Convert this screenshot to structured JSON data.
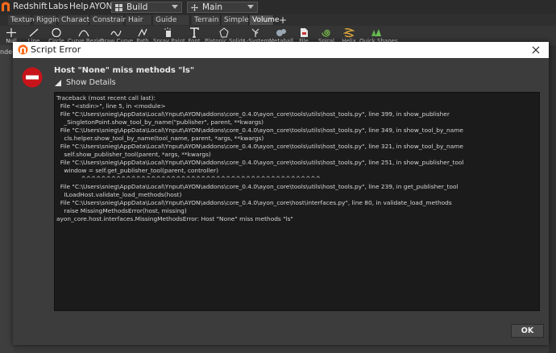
{
  "menubar": {
    "items": [
      "Redshift",
      "Labs",
      "Help",
      "AYON"
    ],
    "desktop_value": "Build",
    "context_value": "Main"
  },
  "shelf_tabs": [
    "Texture",
    "Rigging",
    "Characters",
    "Constraints",
    "Hair Utils",
    "Guide Process",
    "Terrain FX",
    "Simple FX",
    "Volume"
  ],
  "tools": [
    "Null",
    "Line",
    "Circle",
    "Curve Bezier",
    "Draw Curve",
    "Path",
    "Spray Paint",
    "Font",
    "Platonic Solids",
    "L-System",
    "Metaball",
    "File",
    "Spiral",
    "Helix",
    "Quick Shapes"
  ],
  "left_strip_label": "nder",
  "dialog": {
    "title": "Script Error",
    "heading": "Host \"None\" miss methods \"ls\"",
    "show_details": "Show Details",
    "ok": "OK",
    "traceback": [
      "Traceback (most recent call last):",
      "  File \"<stdin>\", line 5, in <module>",
      "  File \"C:\\Users\\snieg\\AppData\\Local\\Ynput\\AYON\\addons\\core_0.4.0\\ayon_core\\tools\\utils\\host_tools.py\", line 399, in show_publisher",
      "    _SingletonPoint.show_tool_by_name(\"publisher\", parent, **kwargs)",
      "  File \"C:\\Users\\snieg\\AppData\\Local\\Ynput\\AYON\\addons\\core_0.4.0\\ayon_core\\tools\\utils\\host_tools.py\", line 349, in show_tool_by_name",
      "    cls.helper.show_tool_by_name(tool_name, parent, *args, **kwargs)",
      "  File \"C:\\Users\\snieg\\AppData\\Local\\Ynput\\AYON\\addons\\core_0.4.0\\ayon_core\\tools\\utils\\host_tools.py\", line 321, in show_tool_by_name",
      "    self.show_publisher_tool(parent, *args, **kwargs)",
      "  File \"C:\\Users\\snieg\\AppData\\Local\\Ynput\\AYON\\addons\\core_0.4.0\\ayon_core\\tools\\utils\\host_tools.py\", line 251, in show_publisher_tool",
      "    window = self.get_publisher_tool(parent, controller)",
      "             ^^^^^^^^^^^^^^^^^^^^^^^^^^^^^^^^^^^^^^^^^^^^^^^^",
      "  File \"C:\\Users\\snieg\\AppData\\Local\\Ynput\\AYON\\addons\\core_0.4.0\\ayon_core\\tools\\utils\\host_tools.py\", line 239, in get_publisher_tool",
      "    ILoadHost.validate_load_methods(host)",
      "  File \"C:\\Users\\snieg\\AppData\\Local\\Ynput\\AYON\\addons\\core_0.4.0\\ayon_core\\host\\interfaces.py\", line 80, in validate_load_methods",
      "    raise MissingMethodsError(host, missing)",
      "ayon_core.host.interfaces.MissingMethodsError: Host \"None\" miss methods \"ls\""
    ]
  }
}
